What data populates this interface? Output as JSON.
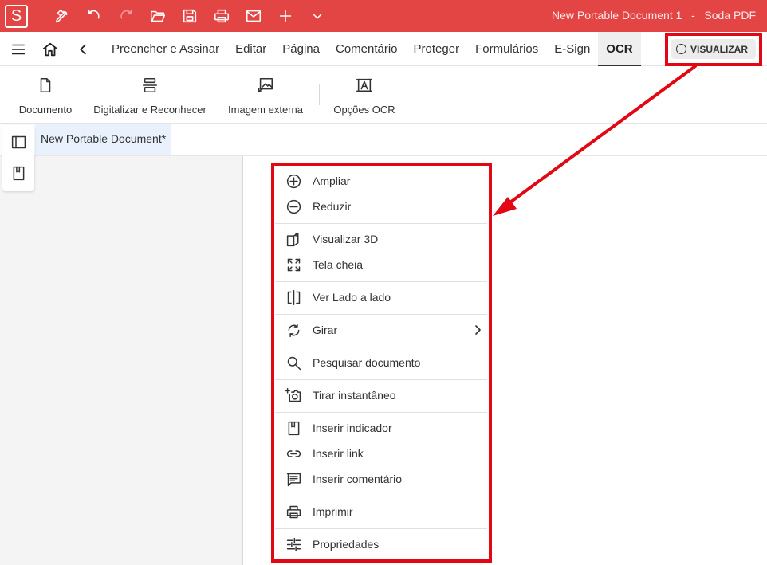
{
  "titlebar": {
    "logo": "S",
    "document_name": "New Portable Document 1",
    "separator": "-",
    "app_name": "Soda PDF",
    "icons": [
      "pen-icon",
      "undo-icon",
      "redo-icon",
      "open-folder-icon",
      "save-icon",
      "print-icon",
      "email-icon",
      "plus-icon",
      "chevron-down-icon"
    ],
    "color": "#e34545"
  },
  "menubar": {
    "icons": [
      "hamburger-menu-icon",
      "home-icon",
      "back-chevron-icon"
    ],
    "tabs": [
      {
        "label": "Preencher e Assinar"
      },
      {
        "label": "Editar"
      },
      {
        "label": "Página"
      },
      {
        "label": "Comentário"
      },
      {
        "label": "Proteger"
      },
      {
        "label": "Formulários"
      },
      {
        "label": "E-Sign"
      },
      {
        "label": "OCR",
        "active": true
      }
    ],
    "view_button": "VISUALIZAR"
  },
  "ribbon": {
    "items": [
      {
        "label": "Documento",
        "icon": "document-icon"
      },
      {
        "label": "Digitalizar e Reconhecer",
        "icon": "scanner-icon"
      },
      {
        "label": "Imagem externa",
        "icon": "image-import-icon"
      },
      {
        "label": "Opções OCR",
        "icon": "ocr-options-icon"
      }
    ]
  },
  "document_tab": {
    "label": "New Portable Document*"
  },
  "side_panel": {
    "icons": [
      "panel-toggle-icon",
      "bookmark-icon"
    ]
  },
  "context_menu": {
    "items": [
      {
        "label": "Ampliar",
        "icon": "zoom-in-icon"
      },
      {
        "label": "Reduzir",
        "icon": "zoom-out-icon"
      },
      {
        "label": "Visualizar 3D",
        "icon": "view-3d-icon"
      },
      {
        "label": "Tela cheia",
        "icon": "fullscreen-icon"
      },
      {
        "label": "Ver Lado a lado",
        "icon": "side-by-side-icon"
      },
      {
        "label": "Girar",
        "icon": "rotate-icon",
        "submenu": true
      },
      {
        "label": "Pesquisar documento",
        "icon": "search-icon"
      },
      {
        "label": "Tirar instantâneo",
        "icon": "snapshot-icon"
      },
      {
        "label": "Inserir indicador",
        "icon": "bookmark-icon"
      },
      {
        "label": "Inserir link",
        "icon": "link-icon"
      },
      {
        "label": "Inserir comentário",
        "icon": "comment-icon"
      },
      {
        "label": "Imprimir",
        "icon": "print-icon"
      },
      {
        "label": "Propriedades",
        "icon": "properties-icon"
      }
    ]
  },
  "annotation": {
    "highlight_color": "#e30613"
  }
}
